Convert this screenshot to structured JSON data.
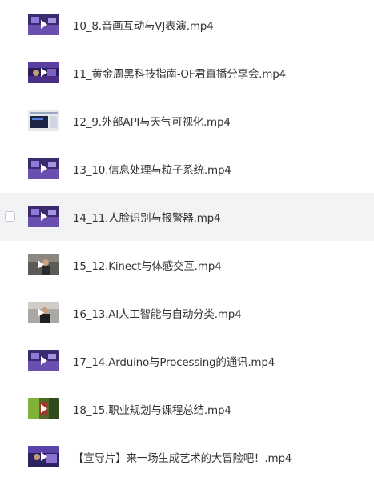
{
  "files": [
    {
      "name": "10_8.音画互动与VJ表演.mp4",
      "thumb": "play-video-thumbnail",
      "selected": false
    },
    {
      "name": "11_黄金周黑科技指南-OF君直播分享会.mp4",
      "thumb": "play-video-thumbnail",
      "selected": false
    },
    {
      "name": "12_9.外部API与天气可视化.mp4",
      "thumb": "video-thumbnail",
      "selected": false
    },
    {
      "name": "13_10.信息处理与粒子系统.mp4",
      "thumb": "play-video-thumbnail",
      "selected": false
    },
    {
      "name": "14_11.人脸识别与报警器.mp4",
      "thumb": "play-video-thumbnail",
      "selected": true
    },
    {
      "name": "15_12.Kinect与体感交互.mp4",
      "thumb": "play-video-thumbnail",
      "selected": false
    },
    {
      "name": "16_13.AI人工智能与自动分类.mp4",
      "thumb": "play-video-thumbnail",
      "selected": false
    },
    {
      "name": "17_14.Arduino与Processing的通讯.mp4",
      "thumb": "play-video-thumbnail",
      "selected": false
    },
    {
      "name": "18_15.职业规划与课程总结.mp4",
      "thumb": "play-video-thumbnail",
      "selected": false
    },
    {
      "name": "【宣导片】来一场生成艺术的大冒险吧！.mp4",
      "thumb": "play-video-thumbnail",
      "selected": false
    }
  ]
}
